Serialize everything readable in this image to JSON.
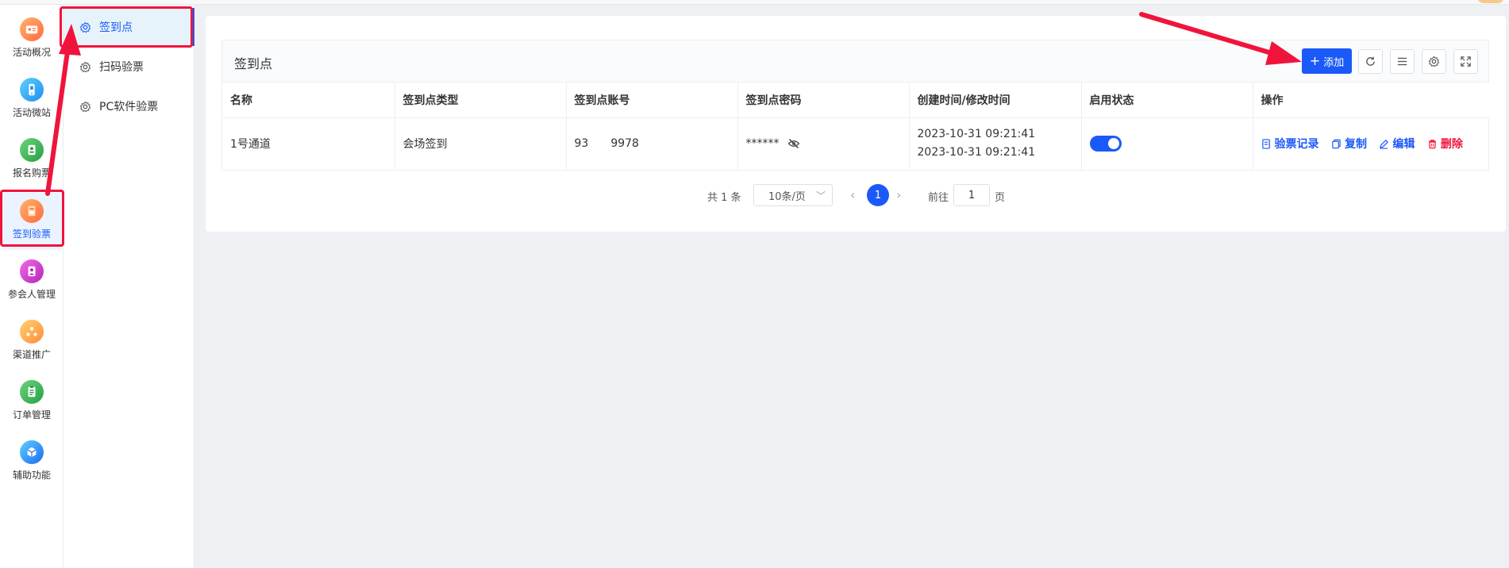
{
  "rail": [
    {
      "name": "rail-item-activity-overview",
      "label": "活动概况",
      "icon": "id-card-icon",
      "color": "#ff8a3d"
    },
    {
      "name": "rail-item-micro-site",
      "label": "活动微站",
      "icon": "phone-icon",
      "color": "#2ab8f0"
    },
    {
      "name": "rail-item-registration",
      "label": "报名购票",
      "icon": "badge-icon",
      "color": "#35b34a"
    },
    {
      "name": "rail-item-checkin",
      "label": "签到验票",
      "icon": "ticket-icon",
      "color": "#ff7a3d",
      "active": true
    },
    {
      "name": "rail-item-attendees",
      "label": "参会人管理",
      "icon": "person-icon",
      "color": "#d43ad1"
    },
    {
      "name": "rail-item-channel",
      "label": "渠道推广",
      "icon": "channel-icon",
      "color": "#ffa33a"
    },
    {
      "name": "rail-item-orders",
      "label": "订单管理",
      "icon": "clipboard-icon",
      "color": "#2ea84b"
    },
    {
      "name": "rail-item-tools",
      "label": "辅助功能",
      "icon": "cube-icon",
      "color": "#1e8ff0"
    }
  ],
  "submenu": [
    {
      "label": "签到点",
      "active": true
    },
    {
      "label": "扫码验票"
    },
    {
      "label": "PC软件验票"
    }
  ],
  "table": {
    "title": "签到点",
    "add_label": "添加",
    "columns": [
      "名称",
      "签到点类型",
      "签到点账号",
      "签到点密码",
      "创建时间/修改时间",
      "启用状态",
      "操作"
    ],
    "rows": [
      {
        "name": "1号通道",
        "type": "会场签到",
        "account_prefix": "93",
        "account_suffix": "9978",
        "password": "******",
        "created": "2023-10-31 09:21:41",
        "modified": "2023-10-31 09:21:41",
        "enabled": true,
        "actions": [
          "验票记录",
          "复制",
          "编辑",
          "删除"
        ]
      }
    ]
  },
  "pagination": {
    "total": "共 1 条",
    "page_size": "10条/页",
    "current": "1",
    "goto_label": "前往",
    "goto_value": "1",
    "page_suffix": "页"
  },
  "colors": {
    "accent": "#1b59f8",
    "danger": "#f0143c",
    "highlight": "#f0143c"
  }
}
